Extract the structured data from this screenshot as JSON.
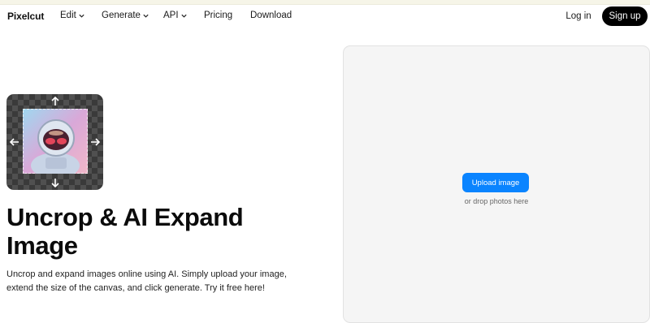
{
  "nav": {
    "logo": "Pixelcut",
    "items": [
      {
        "label": "Edit",
        "dropdown": true
      },
      {
        "label": "Generate",
        "dropdown": true
      },
      {
        "label": "API",
        "dropdown": true
      },
      {
        "label": "Pricing",
        "dropdown": false
      },
      {
        "label": "Download",
        "dropdown": false
      }
    ],
    "login": "Log in",
    "signup": "Sign up"
  },
  "hero": {
    "title": "Uncrop & AI Expand Image",
    "description": "Uncrop and expand images online using AI. Simply upload your image, extend the size of the canvas, and click generate. Try it free here!"
  },
  "upload": {
    "button": "Upload image",
    "drop_text": "or drop photos here"
  },
  "colors": {
    "accent": "#0a84ff",
    "signup_bg": "#000000",
    "panel_bg": "#f5f5f5"
  }
}
